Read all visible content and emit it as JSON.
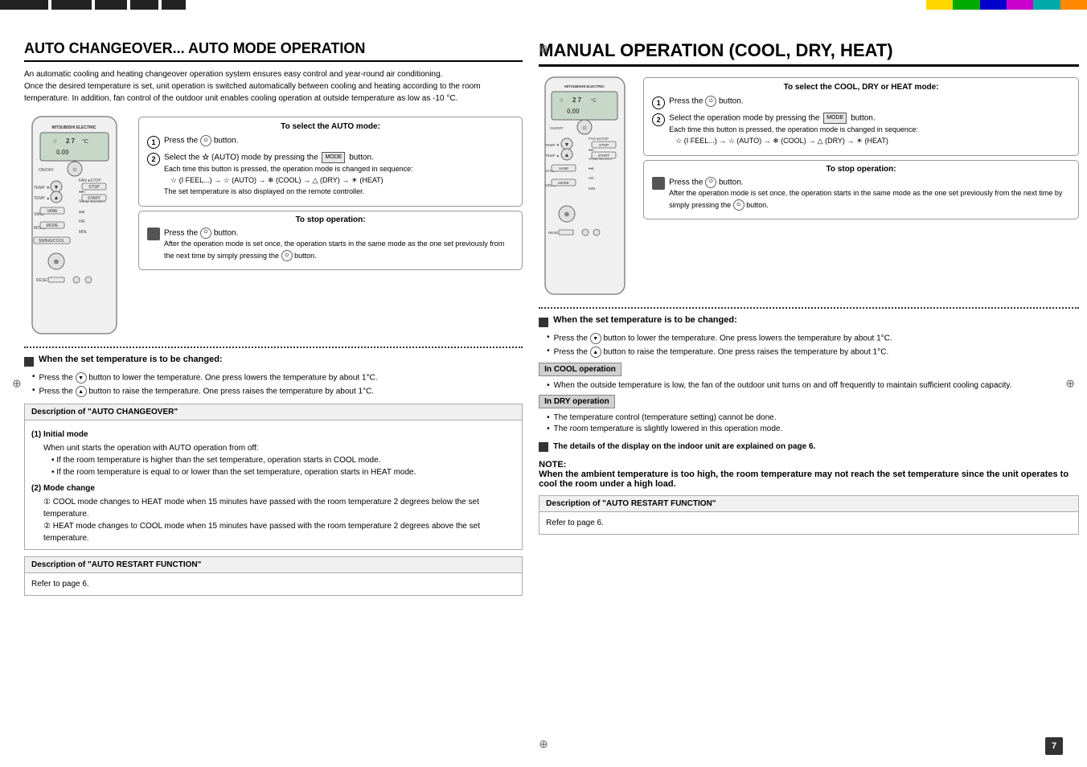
{
  "page": {
    "number": "7",
    "top_bars_left": [
      "#222",
      "#888",
      "#222",
      "#888",
      "#222",
      "#888",
      "#222",
      "#888"
    ],
    "top_bars_right": [
      "#FF0",
      "#0C0",
      "#00C",
      "#F0F",
      "#0CC",
      "#F80"
    ]
  },
  "left_section": {
    "title": "AUTO CHANGEOVER... AUTO MODE OPERATION",
    "intro": [
      "An automatic cooling and heating changeover operation system ensures easy control and year-round air conditioning.",
      "Once the desired temperature is set, unit operation is switched automatically between cooling and heating according to the room temperature. In addition, fan control of the outdoor unit enables cooling operation at outside temperature as low as -10 °C."
    ],
    "select_auto_box": {
      "title": "To select the AUTO mode:",
      "step1_label": "Press the",
      "step1_icon": "ON/OFF",
      "step1_suffix": "button.",
      "step2_label": "Select the",
      "step2_mode": "AUTO",
      "step2_middle": "(AUTO) mode by pressing the",
      "step2_btn": "MODE",
      "step2_suffix": "button.",
      "step2_note": "Each time this button is pressed, the operation mode is changed in sequence:",
      "step2_seq": "☆ (I FEEL...) → ☆ (AUTO) → ❄ (COOL) → △ (DRY) → ☀ (HEAT)",
      "step2_note2": "The set temperature is also displayed on the remote controller."
    },
    "stop_op": {
      "title": "To stop operation:",
      "step": "Press the",
      "step_icon": "ON/OFF",
      "step_suffix": "button.",
      "note": "After the operation mode is set once, the operation starts in the same mode as the one set previously from the next time by simply pressing the",
      "note_icon": "ON/OFF",
      "note_suffix": "button."
    },
    "temp_change": {
      "title": "When the set temperature is to be changed:",
      "items": [
        "Press the ▼ button to lower the temperature. One press lowers the temperature by about 1°C.",
        "Press the ▲ button to raise the temperature. One press raises the temperature by about 1°C."
      ]
    },
    "desc_auto": {
      "title": "Description of \"AUTO CHANGEOVER\"",
      "initial_mode_title": "(1) Initial mode",
      "initial_mode_items": [
        "When unit starts the operation with AUTO operation from off:",
        "If the room temperature is higher than the set temperature, operation starts in COOL mode.",
        "If the room temperature is equal to or lower than the set temperature, operation starts in HEAT mode."
      ],
      "mode_change_title": "(2) Mode change",
      "mode_change_items": [
        "① COOL mode changes to HEAT mode when 15 minutes have passed with the room temperature 2 degrees below the set temperature.",
        "② HEAT mode changes to COOL mode when 15 minutes have passed with the room temperature 2 degrees above the set temperature."
      ]
    },
    "desc_restart": {
      "title": "Description of \"AUTO RESTART FUNCTION\"",
      "content": "Refer to page 6."
    }
  },
  "right_section": {
    "title": "MANUAL OPERATION (COOL, DRY, HEAT)",
    "select_mode_box": {
      "title": "To select the COOL, DRY or HEAT mode:",
      "step1_label": "Press the",
      "step1_icon": "ON/OFF",
      "step1_suffix": "button.",
      "step2_label": "Select the operation mode by pressing the",
      "step2_btn": "MODE",
      "step2_suffix": "button.",
      "step2_note": "Each time this button is pressed, the operation mode is changed in sequence:",
      "step2_seq": "☆ (I FEEL...) → ☆ (AUTO) → ❄ (COOL) → △ (DRY) → ☀ (HEAT)"
    },
    "stop_op": {
      "title": "To stop operation:",
      "step": "Press the",
      "step_icon": "ON/OFF",
      "step_suffix": "button.",
      "note": "After the operation mode is set once, the operation starts in the same mode as the one set previously from the next time by simply pressing the",
      "note_icon": "ON/OFF",
      "note_suffix": "button."
    },
    "temp_change": {
      "title": "When the set temperature is to be changed:",
      "items": [
        "Press the ▼ button to lower the temperature. One press lowers the temperature by about 1°C.",
        "Press the ▲ button to raise the temperature. One press raises the temperature by about 1°C."
      ]
    },
    "in_cool": {
      "title": "In COOL operation",
      "text": "When the outside temperature is low, the fan of the outdoor unit turns on and off frequently to maintain sufficient cooling capacity."
    },
    "in_dry": {
      "title": "In DRY operation",
      "items": [
        "The temperature control (temperature setting) cannot be done.",
        "The room temperature is slightly lowered in this operation mode."
      ]
    },
    "display_note": "The details of the display on the indoor unit are explained on page 6.",
    "note_title": "NOTE:",
    "note_text": "When the ambient temperature is too high, the room temperature may not reach the set temperature since the unit operates to cool the room under a high load.",
    "desc_restart": {
      "title": "Description of \"AUTO RESTART FUNCTION\"",
      "content": "Refer to page 6."
    }
  }
}
